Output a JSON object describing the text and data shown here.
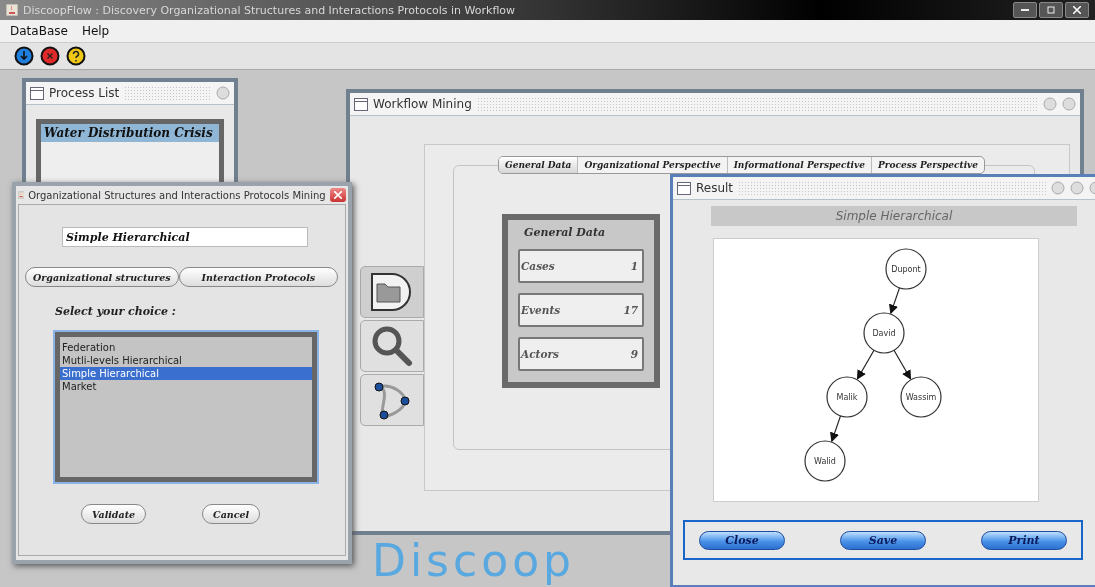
{
  "window": {
    "title": "DiscoopFlow : Discovery Organizational Structures and Interactions Protocols in Workflow"
  },
  "menu": [
    {
      "label": "DataBase"
    },
    {
      "label": "Help"
    }
  ],
  "toolbar": [
    {
      "kind": "down"
    },
    {
      "kind": "stop"
    },
    {
      "kind": "help"
    }
  ],
  "process_list": {
    "title": "Process List",
    "items": [
      {
        "label": "Water Distribution Crisis",
        "selected": true
      }
    ]
  },
  "workflow_mining": {
    "title": "Workflow Mining",
    "side_buttons": [
      {
        "kind": "folder",
        "selected": true
      },
      {
        "kind": "search",
        "selected": false
      },
      {
        "kind": "network",
        "selected": false
      }
    ],
    "tabs": [
      {
        "label": "General Data",
        "selected": true
      },
      {
        "label": "Organizational Perspective",
        "selected": false
      },
      {
        "label": "Informational Perspective",
        "selected": false
      },
      {
        "label": "Process Perspective",
        "selected": false
      }
    ],
    "general_data": {
      "title": "General Data",
      "fields": [
        {
          "label": "Cases",
          "value": "1"
        },
        {
          "label": "Events",
          "value": "17"
        },
        {
          "label": "Actors",
          "value": "9"
        }
      ]
    }
  },
  "result": {
    "title": "Result",
    "heading": "Simple Hierarchical",
    "tree": {
      "name": "Dupont",
      "children": [
        {
          "name": "David",
          "children": [
            {
              "name": "Malik",
              "children": [
                {
                  "name": "Walid"
                }
              ]
            },
            {
              "name": "Wassim"
            }
          ]
        }
      ]
    },
    "buttons": [
      "Close",
      "Save",
      "Print"
    ]
  },
  "dialog": {
    "title": "Organizational Structures and Interactions Protocols Mining",
    "value": "Simple Hierarchical",
    "mode_buttons": [
      "Organizational structures",
      "Interaction Protocols"
    ],
    "prompt": "Select your choice :",
    "options": [
      {
        "label": "Federation",
        "selected": false
      },
      {
        "label": "Mutli-levels Hierarchical",
        "selected": false
      },
      {
        "label": "Simple Hierarchical",
        "selected": true
      },
      {
        "label": "Market",
        "selected": false
      }
    ],
    "actions": [
      "Validate",
      "Cancel"
    ]
  },
  "background_logo": "Discoop"
}
